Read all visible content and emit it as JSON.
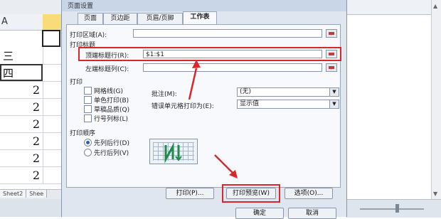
{
  "spreadsheet": {
    "column_header": "A",
    "rows": [
      {
        "text": "三",
        "kind": "text"
      },
      {
        "text": "四",
        "kind": "text"
      },
      {
        "text": "2",
        "kind": "num"
      },
      {
        "text": "2",
        "kind": "num"
      },
      {
        "text": "2",
        "kind": "num"
      },
      {
        "text": "2",
        "kind": "num"
      },
      {
        "text": "2",
        "kind": "num"
      },
      {
        "text": "2",
        "kind": "num"
      }
    ],
    "sheet_tabs": [
      "Sheet2",
      "Shee"
    ]
  },
  "dialog": {
    "title": "页面设置",
    "tabs": [
      "页面",
      "页边距",
      "页眉/页脚",
      "工作表"
    ],
    "active_tab": "工作表",
    "print_area_label": "打印区域(A):",
    "print_titles_label": "打印标题",
    "rows_repeat_label": "顶端标题行(R):",
    "rows_repeat_value": "$1:$1",
    "cols_repeat_label": "左端标题列(C):",
    "print_section_label": "打印",
    "checkboxes": [
      "网格线(G)",
      "单色打印(B)",
      "草稿品质(Q)",
      "行号列标(L)"
    ],
    "comments_label": "批注(M):",
    "comments_value": "(无)",
    "errors_label": "错误单元格打印为(E):",
    "errors_value": "显示值",
    "order_label": "打印顺序",
    "order_options": [
      "先列后行(D)",
      "先行后列(V)"
    ],
    "buttons": {
      "print": "打印(P)...",
      "print_preview": "打印预览(W)",
      "options": "选项(O)...",
      "ok": "确定",
      "cancel": "取消"
    }
  },
  "colors": {
    "highlight": "#d9262b",
    "dialog_bg": "#dfe6f0",
    "active_cell_fill": "#f9dc7a"
  }
}
